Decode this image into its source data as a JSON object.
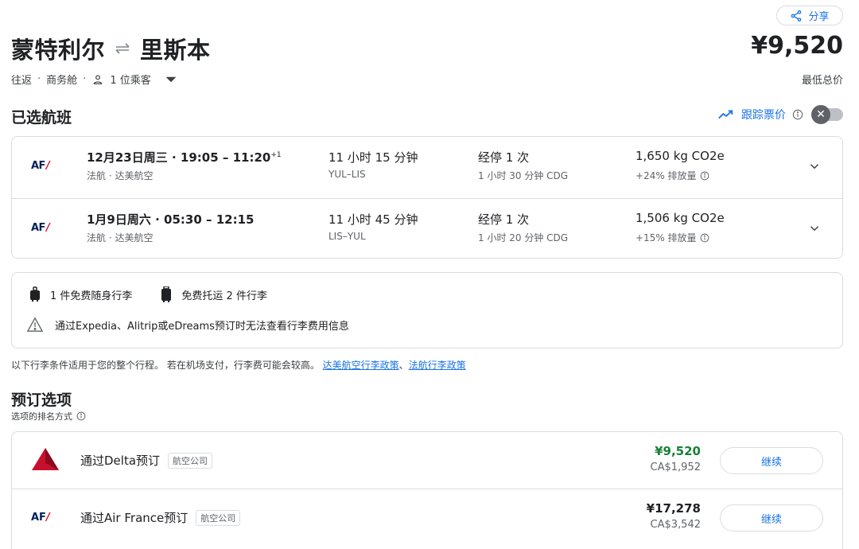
{
  "share": {
    "label": "分享"
  },
  "route": {
    "origin": "蒙特利尔",
    "destination": "里斯本"
  },
  "price": {
    "total": "¥9,520",
    "label": "最低总价"
  },
  "trip": {
    "type": "往返",
    "cabin": "商务舱",
    "passengers": "1 位乘客"
  },
  "selected": {
    "title": "已选航班",
    "track_label": "跟踪票价",
    "flights": [
      {
        "airline_logo": "AF",
        "datetime": "12月23日周三 · 19:05 – 11:20",
        "plus_days": "+1",
        "airline": "法航 · 达美航空",
        "duration": "11 小时 15 分钟",
        "route": "YUL–LIS",
        "stops": "经停 1 次",
        "layover": "1 小时 30 分钟 CDG",
        "co2": "1,650 kg CO2e",
        "emissions": "+24% 排放量"
      },
      {
        "airline_logo": "AF",
        "datetime": "1月9日周六 · 05:30 – 12:15",
        "plus_days": "",
        "airline": "法航 · 达美航空",
        "duration": "11 小时 45 分钟",
        "route": "LIS–YUL",
        "stops": "经停 1 次",
        "layover": "1 小时 20 分钟 CDG",
        "co2": "1,506 kg CO2e",
        "emissions": "+15% 排放量"
      }
    ]
  },
  "baggage": {
    "carry_on": "1 件免费随身行李",
    "checked": "免费托运 2 件行李",
    "warning": "通过Expedia、Alitrip或eDreams预订时无法查看行李费用信息"
  },
  "policy": {
    "text": "以下行李条件适用于您的整个行程。 若在机场支付，行李费可能会较高。",
    "link1": "达美航空行李政策",
    "sep": "、",
    "link2": "法航行李政策"
  },
  "booking": {
    "title": "预订选项",
    "sort_note": "选项的排名方式",
    "options": [
      {
        "name": "通过Delta预订",
        "tag": "航空公司",
        "price": "¥9,520",
        "cad": "CA$1,952",
        "button": "继续",
        "logo": "delta"
      },
      {
        "name": "通过Air France预订",
        "tag": "航空公司",
        "price": "¥17,278",
        "cad": "CA$3,542",
        "button": "继续",
        "logo": "AF"
      }
    ]
  },
  "colors": {
    "accent": "#1a73e8",
    "price_green": "#188038",
    "af_red": "#e4002b",
    "af_navy": "#002157",
    "delta_red": "#c8102e"
  }
}
